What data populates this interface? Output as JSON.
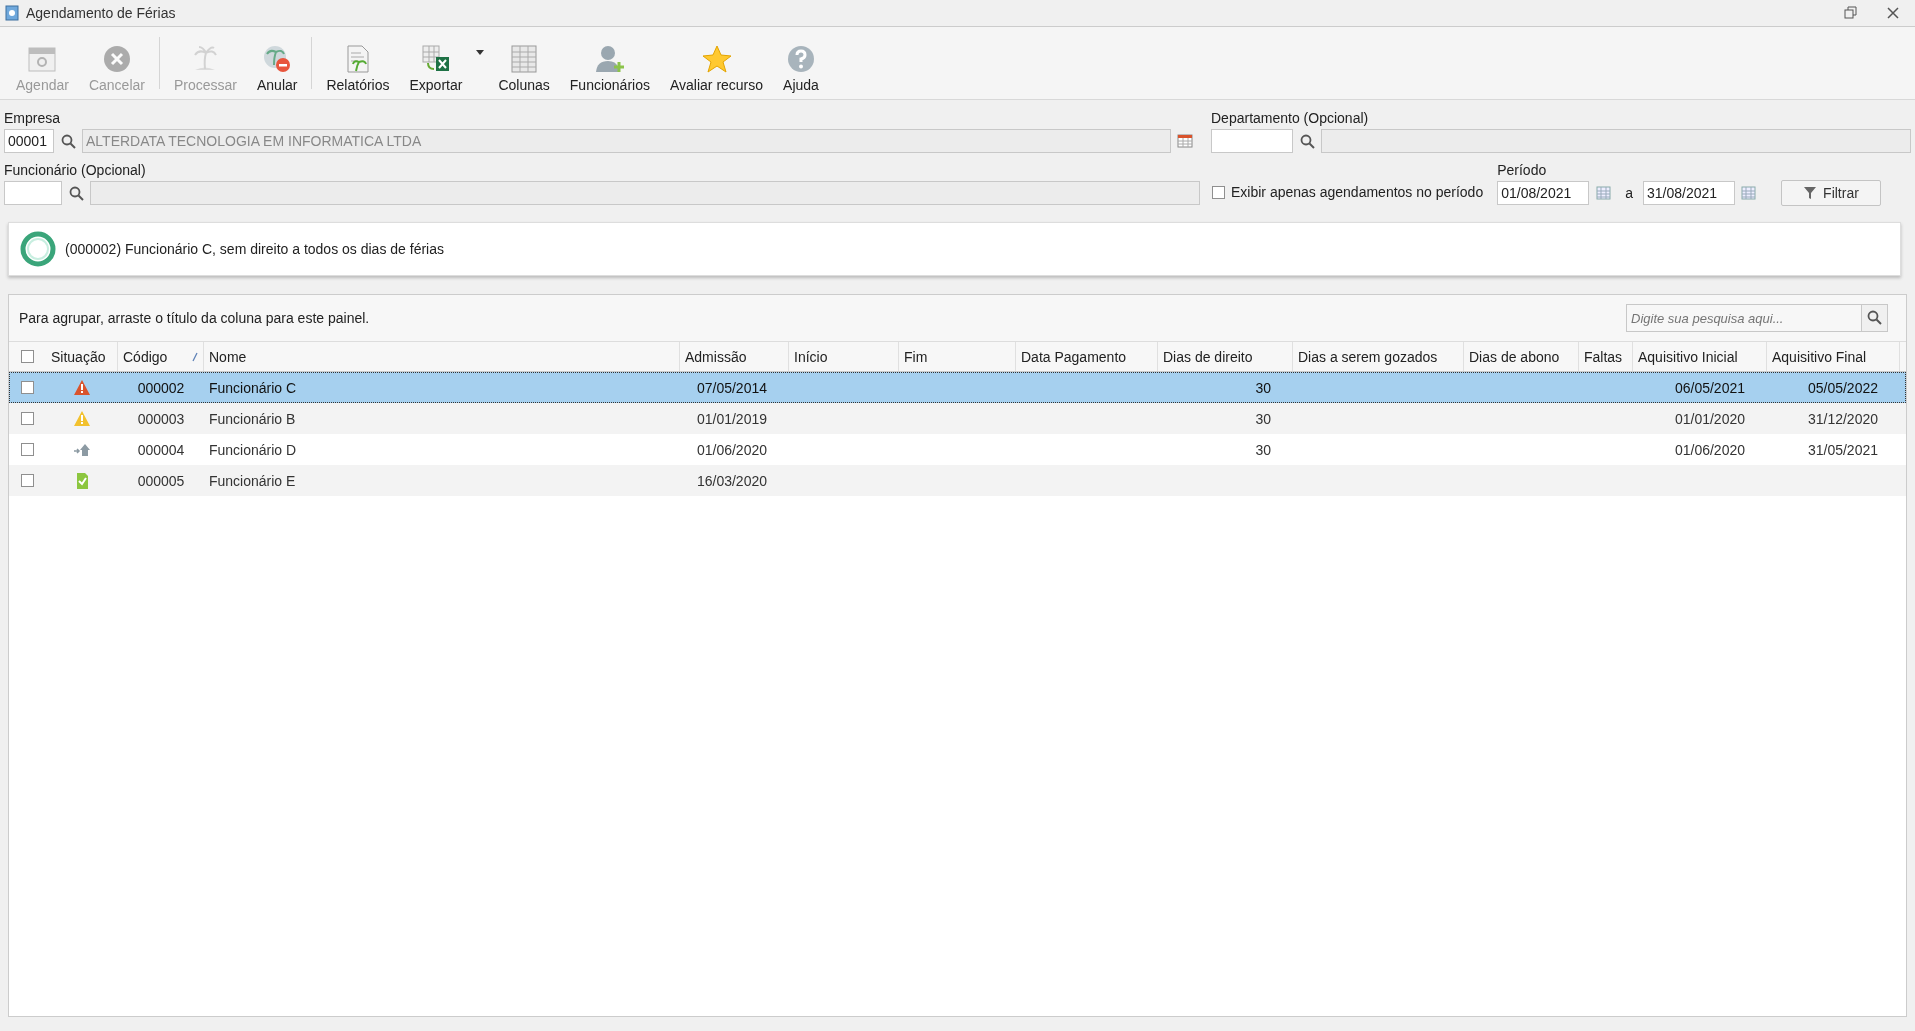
{
  "window": {
    "title": "Agendamento de Férias"
  },
  "toolbar": [
    {
      "label": "Agendar",
      "disabled": true
    },
    {
      "label": "Cancelar",
      "disabled": true
    },
    {
      "label": "Processar",
      "disabled": true
    },
    {
      "label": "Anular",
      "disabled": false
    },
    {
      "label": "Relatórios",
      "disabled": false
    },
    {
      "label": "Exportar",
      "disabled": false
    },
    {
      "label": "Colunas",
      "disabled": false
    },
    {
      "label": "Funcionários",
      "disabled": false
    },
    {
      "label": "Avaliar recurso",
      "disabled": false
    },
    {
      "label": "Ajuda",
      "disabled": false
    }
  ],
  "filters": {
    "empresa": {
      "label": "Empresa",
      "code": "00001",
      "name": "ALTERDATA TECNOLOGIA EM INFORMATICA LTDA"
    },
    "departamento": {
      "label": "Departamento (Opcional)"
    },
    "funcionario": {
      "label": "Funcionário (Opcional)"
    },
    "only_in_period": {
      "label": "Exibir apenas agendamentos no período",
      "checked": false
    },
    "periodo": {
      "label": "Período",
      "from": "01/08/2021",
      "separator": "a",
      "to": "31/08/2021"
    },
    "filter_button": "Filtrar"
  },
  "message": "(000002) Funcionário C, sem direito a todos os dias de férias",
  "grid": {
    "group_hint": "Para agrupar, arraste o título da coluna para este painel.",
    "search": {
      "placeholder": "Digite sua pesquisa aqui..."
    },
    "select_all": false,
    "columns": [
      {
        "label": "Situação"
      },
      {
        "label": "Código",
        "sorted": true
      },
      {
        "label": "Nome"
      },
      {
        "label": "Admissão"
      },
      {
        "label": "Início"
      },
      {
        "label": "Fim"
      },
      {
        "label": "Data Pagamento"
      },
      {
        "label": "Dias de direito"
      },
      {
        "label": "Dias a serem gozados"
      },
      {
        "label": "Dias de abono"
      },
      {
        "label": "Faltas"
      },
      {
        "label": "Aquisitivo Inicial"
      },
      {
        "label": "Aquisitivo Final"
      }
    ],
    "rows": [
      {
        "checked": false,
        "selected": true,
        "kind": "error",
        "cells": [
          "",
          "000002",
          "Funcionário C",
          "07/05/2014",
          "",
          "",
          "",
          "30",
          "",
          "",
          "",
          "06/05/2021",
          "05/05/2022"
        ]
      },
      {
        "checked": false,
        "selected": false,
        "kind": "warning",
        "cells": [
          "",
          "000003",
          "Funcionário B",
          "01/01/2019",
          "",
          "",
          "",
          "30",
          "",
          "",
          "",
          "01/01/2020",
          "31/12/2020"
        ]
      },
      {
        "checked": false,
        "selected": false,
        "kind": "home",
        "cells": [
          "",
          "000004",
          "Funcionário D",
          "01/06/2020",
          "",
          "",
          "",
          "30",
          "",
          "",
          "",
          "01/06/2020",
          "31/05/2021"
        ]
      },
      {
        "checked": false,
        "selected": false,
        "kind": "ok",
        "cells": [
          "",
          "000005",
          "Funcionário E",
          "16/03/2020",
          "",
          "",
          "",
          "",
          "",
          "",
          "",
          "",
          ""
        ]
      }
    ]
  }
}
